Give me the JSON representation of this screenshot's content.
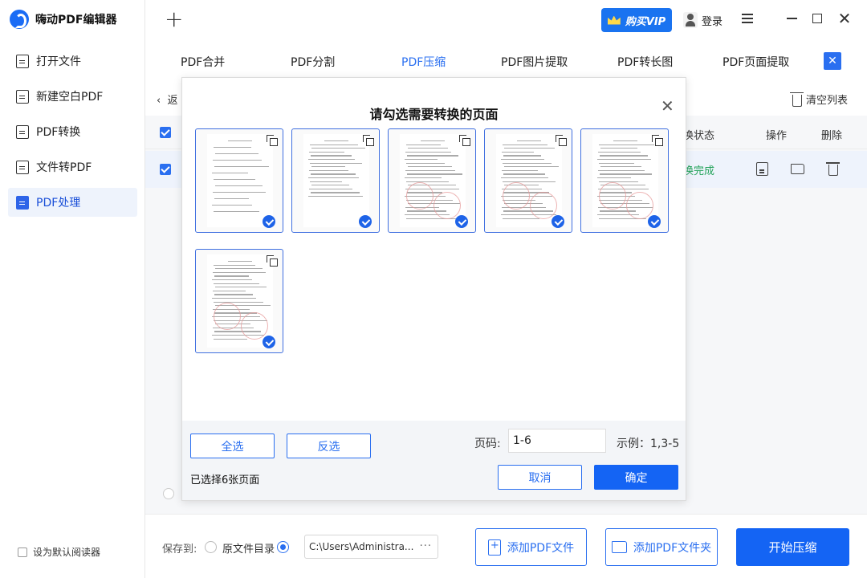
{
  "app": {
    "title": "嗨动PDF编辑器"
  },
  "sidebar": {
    "items": [
      {
        "label": "打开文件"
      },
      {
        "label": "新建空白PDF"
      },
      {
        "label": "PDF转换"
      },
      {
        "label": "文件转PDF"
      },
      {
        "label": "PDF处理"
      }
    ],
    "default_reader_label": "设为默认阅读器"
  },
  "topbar": {
    "vip_label": "购买VIP",
    "login_label": "登录"
  },
  "tabs": [
    {
      "label": "PDF合并"
    },
    {
      "label": "PDF分割"
    },
    {
      "label": "PDF压缩"
    },
    {
      "label": "PDF图片提取"
    },
    {
      "label": "PDF转长图"
    },
    {
      "label": "PDF页面提取"
    }
  ],
  "list": {
    "back_label": "返",
    "clear_label": "清空列表",
    "headers": {
      "status": "换状态",
      "operation": "操作",
      "delete": "删除"
    },
    "row": {
      "status": "换完成"
    }
  },
  "bottom": {
    "save_to_label": "保存到:",
    "original_dir_label": "原文件目录",
    "path_value": "C:\\Users\\Administra...",
    "path_more": "···",
    "add_file_label": "添加PDF文件",
    "add_folder_label": "添加PDF文件夹",
    "start_label": "开始压缩"
  },
  "modal": {
    "title": "请勾选需要转换的页面",
    "select_all_label": "全选",
    "invert_label": "反选",
    "page_label": "页码:",
    "page_value": "1-6",
    "example_label": "示例：1,3-5",
    "selected_count": "已选择6张页面",
    "cancel_label": "取消",
    "confirm_label": "确定",
    "pages": [
      {
        "page": 1,
        "selected": true
      },
      {
        "page": 2,
        "selected": true
      },
      {
        "page": 3,
        "selected": true
      },
      {
        "page": 4,
        "selected": true
      },
      {
        "page": 5,
        "selected": true
      },
      {
        "page": 6,
        "selected": true
      }
    ]
  },
  "colors": {
    "accent": "#1464f4",
    "status_done": "#23a35a",
    "vip": "#1a73f0"
  }
}
